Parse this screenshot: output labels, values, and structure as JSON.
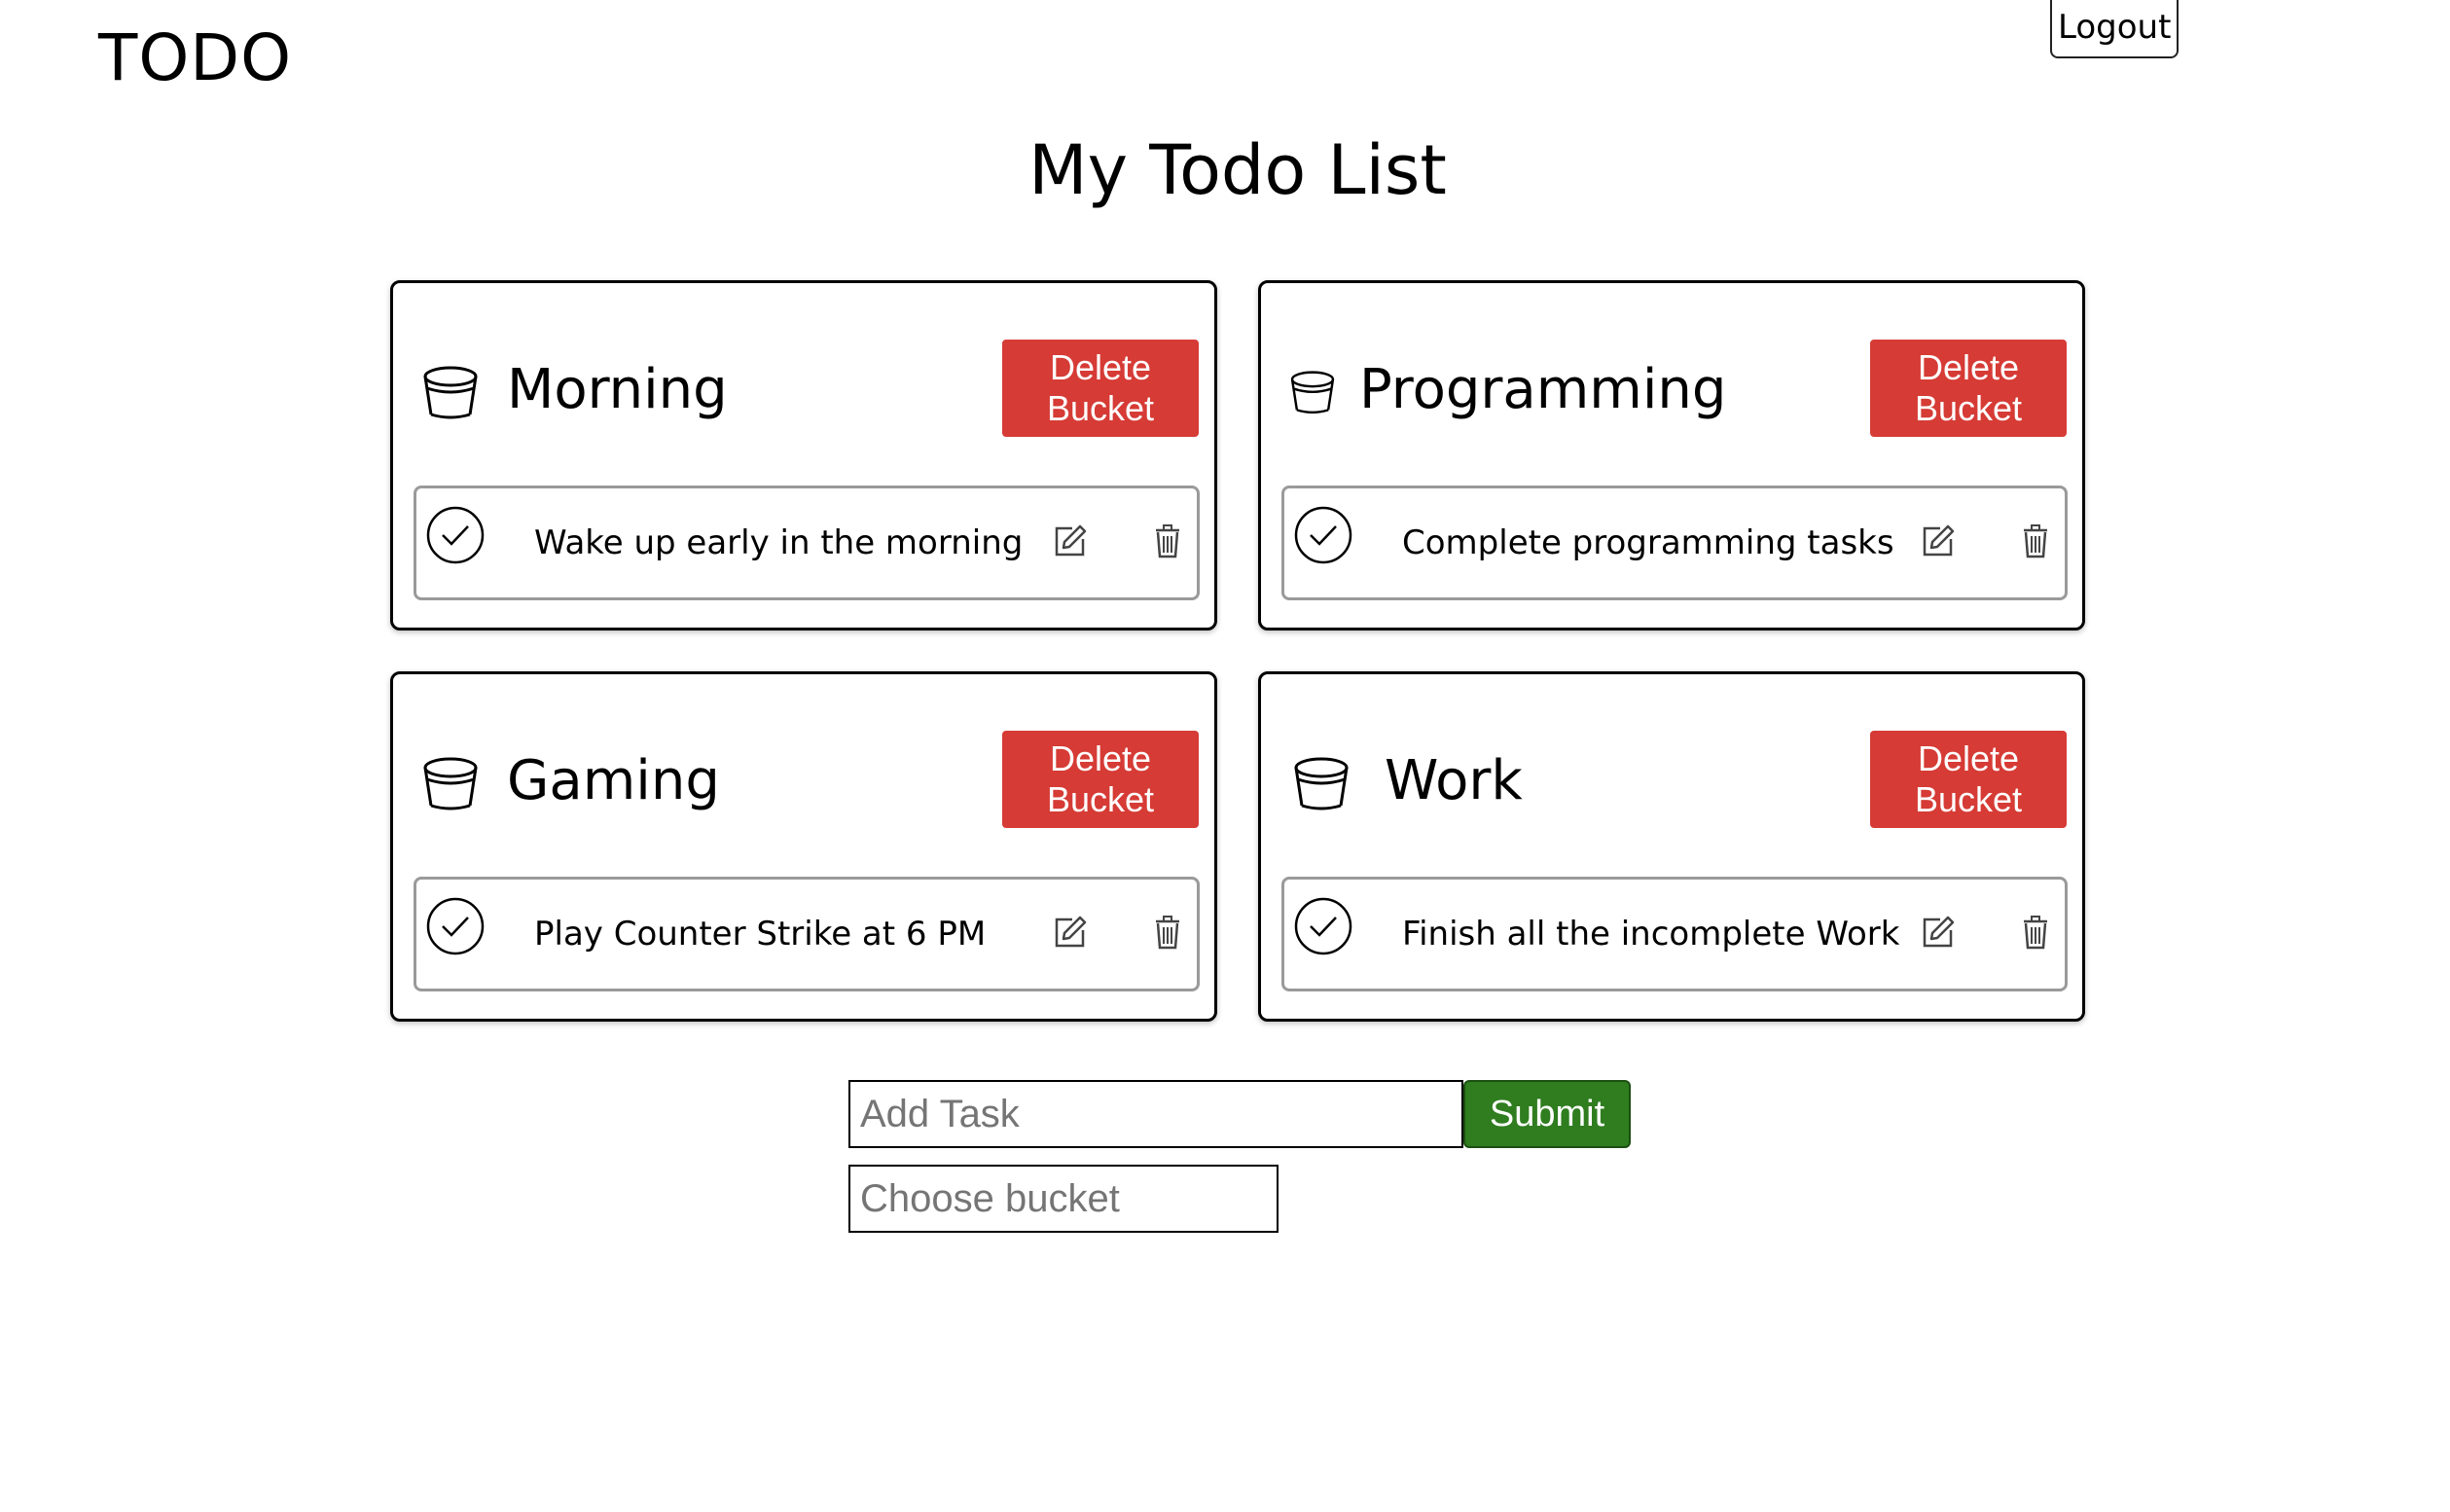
{
  "header": {
    "brand": "TODO",
    "logout_label": "Logout"
  },
  "page_title": "My Todo List",
  "buckets": [
    {
      "name": "Morning",
      "delete_label": "Delete Bucket",
      "icon": "bucket-icon",
      "tasks": [
        {
          "text": "Wake up early in the morning",
          "check_icon": "check-circle-icon",
          "edit_icon": "edit-icon",
          "delete_icon": "trash-icon"
        }
      ]
    },
    {
      "name": "Programming",
      "delete_label": "Delete Bucket",
      "icon": "bucket-icon",
      "tasks": [
        {
          "text": "Complete programming tasks",
          "check_icon": "check-circle-icon",
          "edit_icon": "edit-icon",
          "delete_icon": "trash-icon"
        }
      ]
    },
    {
      "name": "Gaming",
      "delete_label": "Delete Bucket",
      "icon": "bucket-icon",
      "tasks": [
        {
          "text": "Play Counter Strike at 6 PM",
          "check_icon": "check-circle-icon",
          "edit_icon": "edit-icon",
          "delete_icon": "trash-icon"
        }
      ]
    },
    {
      "name": "Work",
      "delete_label": "Delete Bucket",
      "icon": "bucket-icon",
      "tasks": [
        {
          "text": "Finish all the incomplete Work",
          "check_icon": "check-circle-icon",
          "edit_icon": "edit-icon",
          "delete_icon": "trash-icon"
        }
      ]
    }
  ],
  "form": {
    "task_placeholder": "Add Task",
    "task_value": "",
    "submit_label": "Submit",
    "bucket_placeholder": "Choose bucket",
    "bucket_value": ""
  },
  "colors": {
    "delete_button": "#d63b35",
    "submit_button": "#2f7d1f",
    "card_border": "#000000",
    "task_border": "#9a9a9a"
  }
}
